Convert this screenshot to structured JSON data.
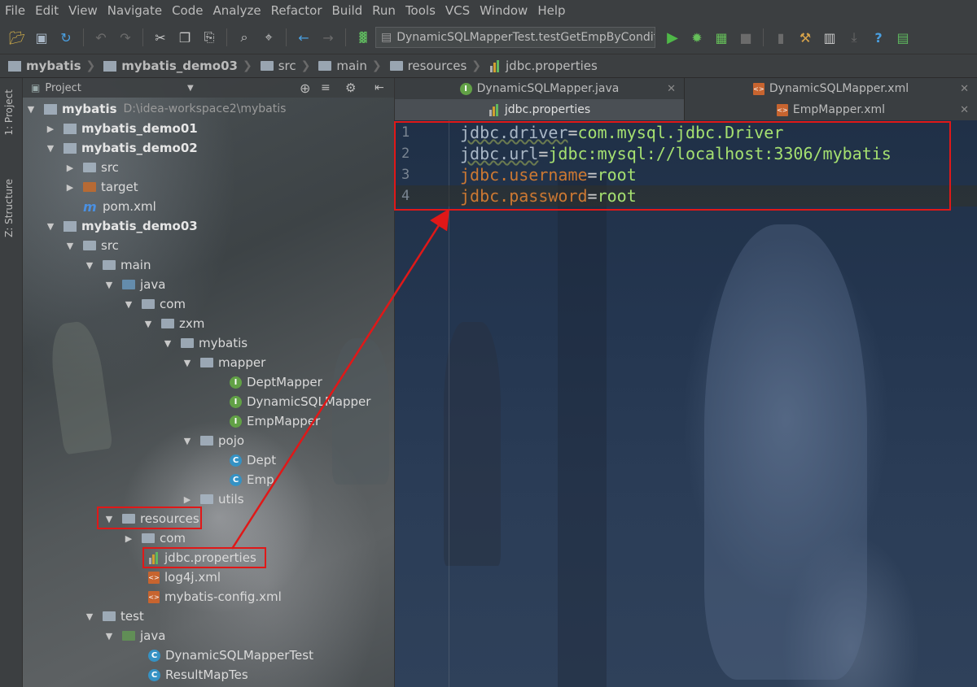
{
  "menu": [
    "File",
    "Edit",
    "View",
    "Navigate",
    "Code",
    "Analyze",
    "Refactor",
    "Build",
    "Run",
    "Tools",
    "VCS",
    "Window",
    "Help"
  ],
  "toolbar": {
    "run_config": "DynamicSQLMapperTest.testGetEmpByConditi..."
  },
  "breadcrumb": [
    "mybatis",
    "mybatis_demo03",
    "src",
    "main",
    "resources",
    "jdbc.properties"
  ],
  "side_tabs": {
    "project": "1: Project",
    "structure": "Z: Structure"
  },
  "project_panel": {
    "title": "Project",
    "root": {
      "name": "mybatis",
      "path": "D:\\idea-workspace2\\mybatis"
    },
    "tree": [
      {
        "label": "mybatis_demo01",
        "bold": true
      },
      {
        "label": "mybatis_demo02",
        "bold": true
      },
      {
        "label": "src"
      },
      {
        "label": "target"
      },
      {
        "label": "pom.xml"
      },
      {
        "label": "mybatis_demo03",
        "bold": true
      },
      {
        "label": "src"
      },
      {
        "label": "main"
      },
      {
        "label": "java"
      },
      {
        "label": "com"
      },
      {
        "label": "zxm"
      },
      {
        "label": "mybatis"
      },
      {
        "label": "mapper"
      },
      {
        "label": "DeptMapper"
      },
      {
        "label": "DynamicSQLMapper"
      },
      {
        "label": "EmpMapper"
      },
      {
        "label": "pojo"
      },
      {
        "label": "Dept"
      },
      {
        "label": "Emp"
      },
      {
        "label": "utils"
      },
      {
        "label": "resources"
      },
      {
        "label": "com"
      },
      {
        "label": "jdbc.properties"
      },
      {
        "label": "log4j.xml"
      },
      {
        "label": "mybatis-config.xml"
      },
      {
        "label": "test"
      },
      {
        "label": "java"
      },
      {
        "label": "DynamicSQLMapperTest"
      },
      {
        "label": "ResultMapTes"
      }
    ]
  },
  "editor": {
    "tabs_row1": [
      "DynamicSQLMapper.java",
      "DynamicSQLMapper.xml"
    ],
    "tabs_row2": [
      "jdbc.properties",
      "EmpMapper.xml"
    ],
    "lines": [
      {
        "num": "1",
        "key": "jdbc.driver",
        "eq": "=",
        "val": "com.mysql.jdbc.Driver"
      },
      {
        "num": "2",
        "key": "jdbc.url",
        "eq": "=",
        "val": "jdbc:mysql://localhost:3306/mybatis"
      },
      {
        "num": "3",
        "key": "jdbc.username",
        "eq": "=",
        "val": "root"
      },
      {
        "num": "4",
        "key": "jdbc.password",
        "eq": "=",
        "val": "root"
      }
    ]
  },
  "colors": {
    "annotation": "#e01818",
    "key": "#cc7832",
    "value": "#a5e070"
  }
}
